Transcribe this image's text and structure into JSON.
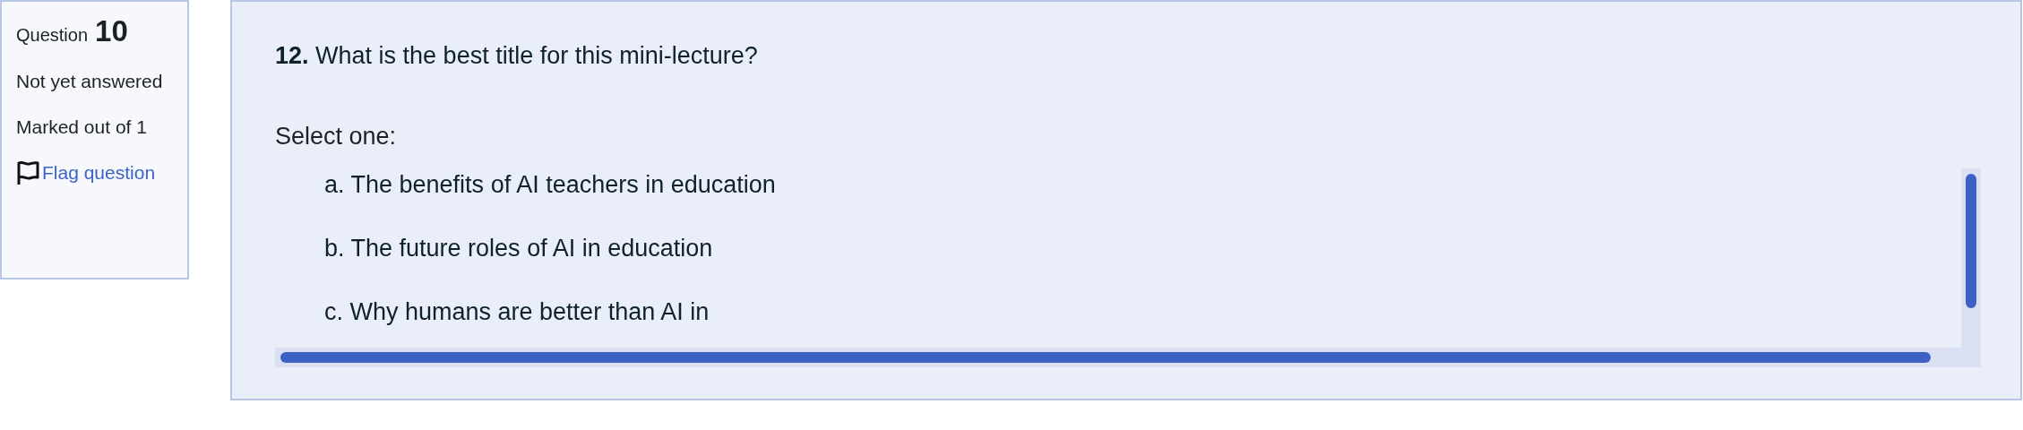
{
  "info": {
    "label": "Question",
    "number": "10",
    "status": "Not yet answered",
    "marks": "Marked out of 1",
    "flag_link": "Flag question"
  },
  "question": {
    "number": "12.",
    "text": "What is the best title for this mini-lecture?",
    "prompt": "Select one:",
    "options": [
      "a. The benefits of AI teachers in education",
      "b. The future roles of AI in education",
      "c. Why humans are better than AI in"
    ]
  }
}
